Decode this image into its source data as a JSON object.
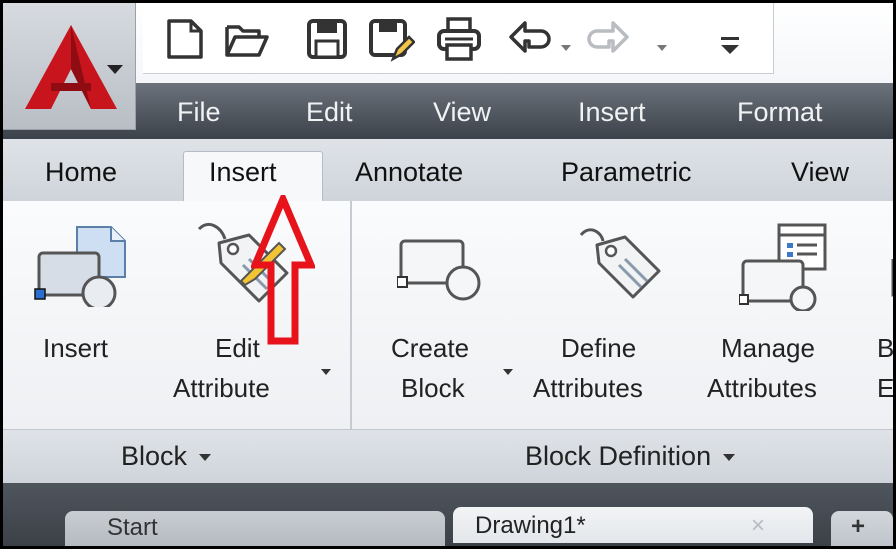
{
  "quick_access": {
    "icons": [
      "new-icon",
      "open-icon",
      "save-icon",
      "save-as-icon",
      "plot-icon",
      "undo-icon",
      "redo-icon",
      "customize-icon"
    ]
  },
  "menubar": {
    "items": [
      {
        "label": "File"
      },
      {
        "label": "Edit"
      },
      {
        "label": "View"
      },
      {
        "label": "Insert"
      },
      {
        "label": "Format"
      }
    ]
  },
  "ribbon_tabs": {
    "items": [
      {
        "label": "Home"
      },
      {
        "label": "Insert"
      },
      {
        "label": "Annotate"
      },
      {
        "label": "Parametric"
      },
      {
        "label": "View"
      }
    ],
    "active": "Insert"
  },
  "ribbon": {
    "block_panel": {
      "title": "Block",
      "buttons": [
        {
          "line1": "Insert",
          "line2": ""
        },
        {
          "line1": "Edit",
          "line2": "Attribute"
        }
      ]
    },
    "block_definition_panel": {
      "title": "Block Definition",
      "buttons": [
        {
          "line1": "Create",
          "line2": "Block"
        },
        {
          "line1": "Define",
          "line2": "Attributes"
        },
        {
          "line1": "Manage",
          "line2": "Attributes"
        },
        {
          "line1": "B",
          "line2": "E"
        }
      ]
    }
  },
  "doc_tabs": {
    "items": [
      {
        "label": "Start"
      },
      {
        "label": "Drawing1*"
      }
    ],
    "close_glyph": "×",
    "new_glyph": "+"
  },
  "colors": {
    "annotation_arrow": "#e8121b",
    "autocad_red": "#c8141c"
  }
}
